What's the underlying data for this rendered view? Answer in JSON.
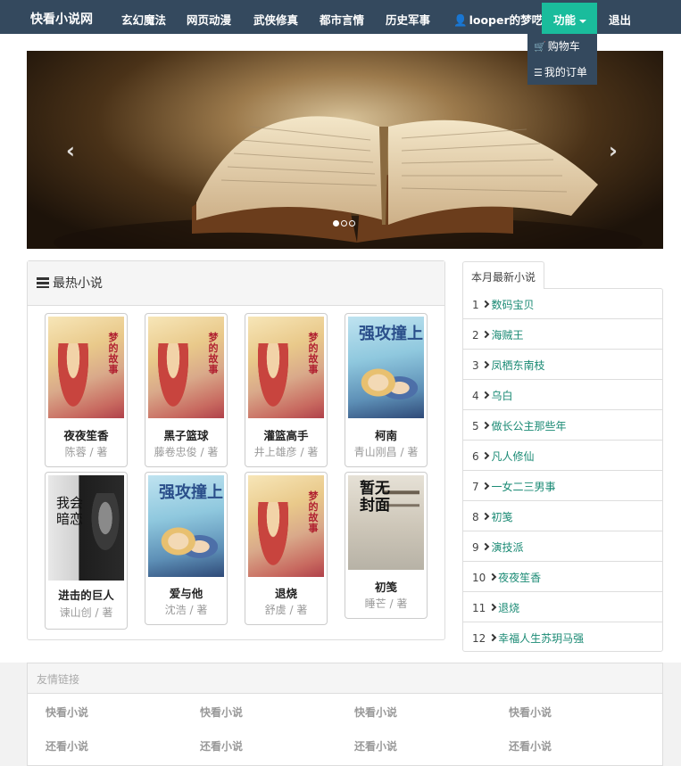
{
  "navbar": {
    "brand": "快看小说网",
    "items": [
      "玄幻魔法",
      "网页动漫",
      "武侠修真",
      "都市言情",
      "历史军事"
    ],
    "user": "looper的梦呓",
    "function_menu": "功能",
    "logout": "退出",
    "dropdown": [
      "购物车",
      "我的订单"
    ]
  },
  "carousel": {
    "prev": "‹",
    "next": "›",
    "slide_count": 3,
    "active_slide": 1
  },
  "hot": {
    "title": "最热小说",
    "books": [
      {
        "name": "夜夜笙香",
        "author": "陈蓉 / 著",
        "cover": "dream",
        "cover_text": "梦的故事"
      },
      {
        "name": "黑子篮球",
        "author": "藤卷忠俊 / 著",
        "cover": "dream",
        "cover_text": "梦的故事"
      },
      {
        "name": "灌篮高手",
        "author": "井上雄彦 / 著",
        "cover": "dream",
        "cover_text": "梦的故事"
      },
      {
        "name": "柯南",
        "author": "青山刚昌 / 著",
        "cover": "love",
        "cover_text": "强攻撞上"
      },
      {
        "name": "进击的巨人",
        "author": "谏山创 / 著",
        "cover": "dark",
        "cover_text": "我会暗恋"
      },
      {
        "name": "爱与他",
        "author": "沈浩 / 著",
        "cover": "love",
        "cover_text": "强攻撞上"
      },
      {
        "name": "退烧",
        "author": "舒虞 / 著",
        "cover": "dream",
        "cover_text": "梦的故事"
      },
      {
        "name": "初笺",
        "author": "睡芒 / 著",
        "cover": "none",
        "cover_text": "暂无封面"
      }
    ]
  },
  "monthly": {
    "tab": "本月最新小说",
    "items": [
      {
        "num": "1",
        "name": "数码宝贝"
      },
      {
        "num": "2",
        "name": "海贼王"
      },
      {
        "num": "3",
        "name": "凤栖东南枝"
      },
      {
        "num": "4",
        "name": "乌白"
      },
      {
        "num": "5",
        "name": "做长公主那些年"
      },
      {
        "num": "6",
        "name": "凡人修仙"
      },
      {
        "num": "7",
        "name": "一女二三男事"
      },
      {
        "num": "8",
        "name": "初笺"
      },
      {
        "num": "9",
        "name": "演技派"
      },
      {
        "num": "10",
        "name": "夜夜笙香"
      },
      {
        "num": "11",
        "name": "退烧"
      },
      {
        "num": "12",
        "name": "幸福人生苏玥马强"
      }
    ]
  },
  "links": {
    "title": "友情链接",
    "row1": [
      "快看小说",
      "快看小说",
      "快看小说",
      "快看小说"
    ],
    "row2": [
      "还看小说",
      "还看小说",
      "还看小说",
      "还看小说"
    ]
  },
  "colors": {
    "navbar": "#34495e",
    "accent": "#1abc9c",
    "link": "#1a8a74"
  }
}
